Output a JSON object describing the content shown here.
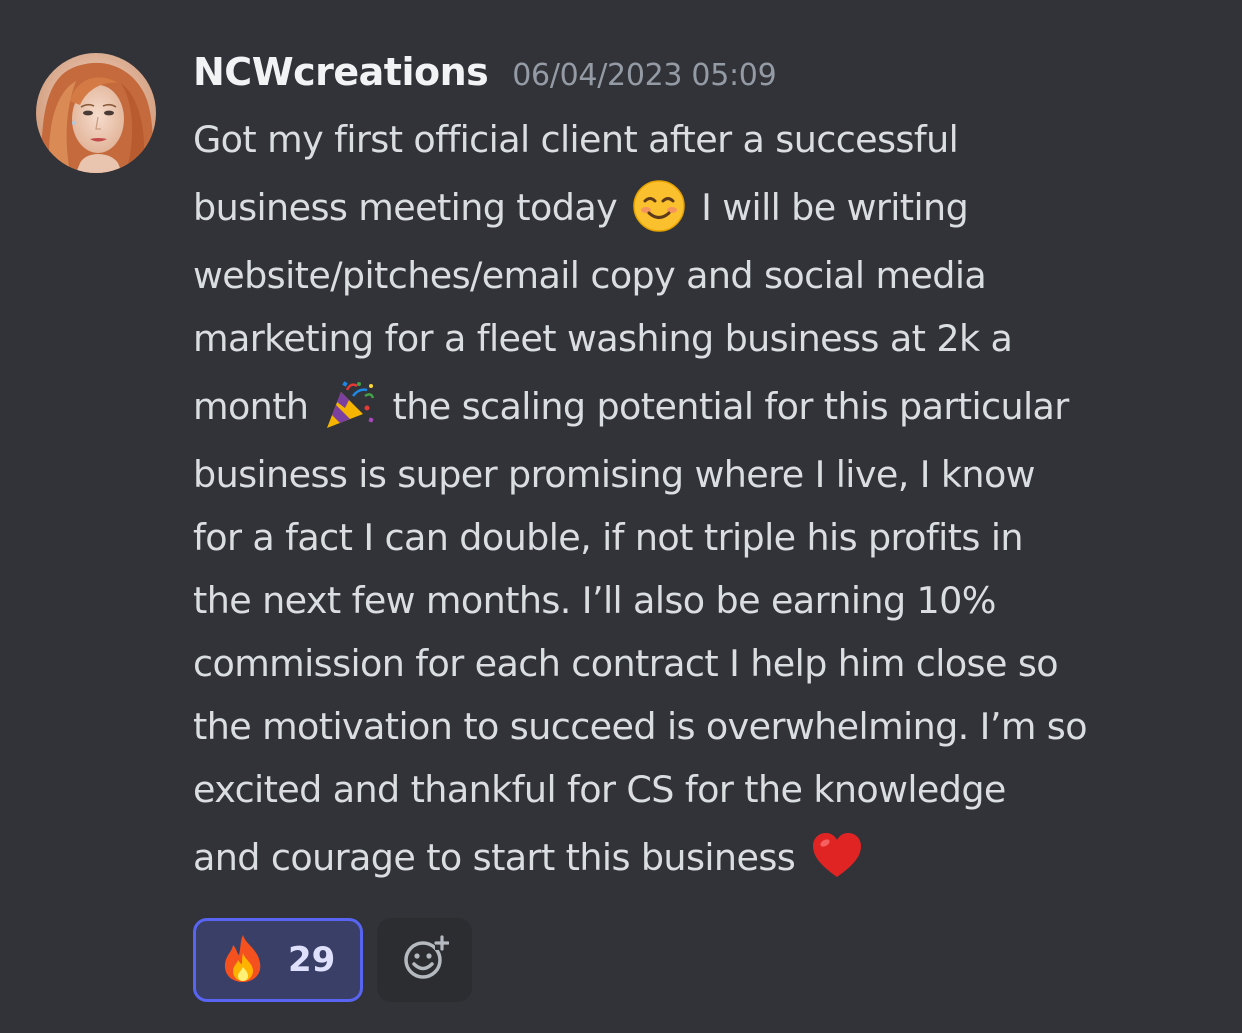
{
  "message": {
    "author": "NCWcreations",
    "timestamp": "06/04/2023 05:09",
    "avatar": "user-avatar",
    "lines": [
      "Got my first official client after a successful",
      "business meeting today",
      "I will be writing",
      "website/pitches/email copy and social media",
      "marketing for a fleet washing business at 2k a",
      "month",
      "the scaling potential for this particular",
      "business is super promising where I live, I know",
      "for a fact I can double, if not triple his profits in",
      "the next few months. I’ll also be earning 10%",
      "commission for each contract I help him close so",
      "the motivation to succeed is overwhelming. I’m so",
      "excited and thankful for CS for the knowledge",
      "and courage to start this business"
    ],
    "emojis": {
      "smiling": "smiling-face-emoji",
      "party": "party-popper-emoji",
      "heart": "red-heart-emoji"
    }
  },
  "reactions": [
    {
      "emoji": "fire-emoji",
      "count": "29",
      "selected": true
    }
  ],
  "add_reaction": {
    "icon": "add-reaction-icon"
  },
  "colors": {
    "background": "#313338",
    "username": "#f2f3f5",
    "timestamp": "#949ba4",
    "text": "#dbdee1",
    "reaction_border": "#5865f2",
    "reaction_bg": "#3b3e7a",
    "add_reaction_bg": "#2b2d31"
  }
}
